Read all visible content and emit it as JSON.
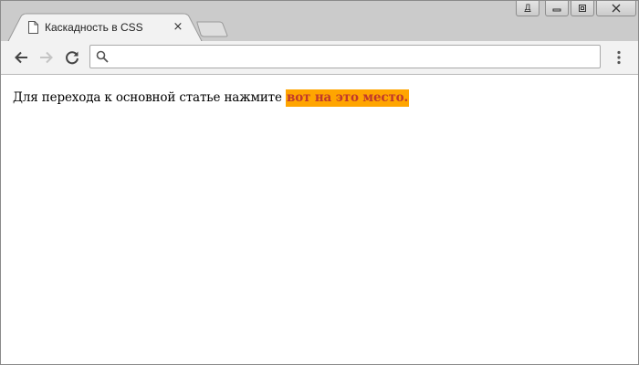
{
  "browser": {
    "tab": {
      "title": "Каскадность в CSS",
      "close_symbol": "×",
      "icon": "document-icon"
    },
    "new_tab_icon": "new-tab-icon",
    "window_controls": {
      "profile_label": "Д",
      "minimize_icon": "minimize-icon",
      "restore_icon": "restore-icon",
      "close_icon": "close-icon"
    },
    "toolbar": {
      "back_icon": "back-arrow-icon",
      "forward_icon": "forward-arrow-icon",
      "reload_icon": "reload-icon",
      "menu_icon": "kebab-menu-icon"
    },
    "omnibox": {
      "search_icon": "search-icon",
      "value": "",
      "placeholder": ""
    }
  },
  "page": {
    "text_before_link": "Для перехода к основной статье нажмите ",
    "link_text": "вот на это место.",
    "link_text_color": "#c0392b",
    "link_background_color": "#ffa500"
  }
}
